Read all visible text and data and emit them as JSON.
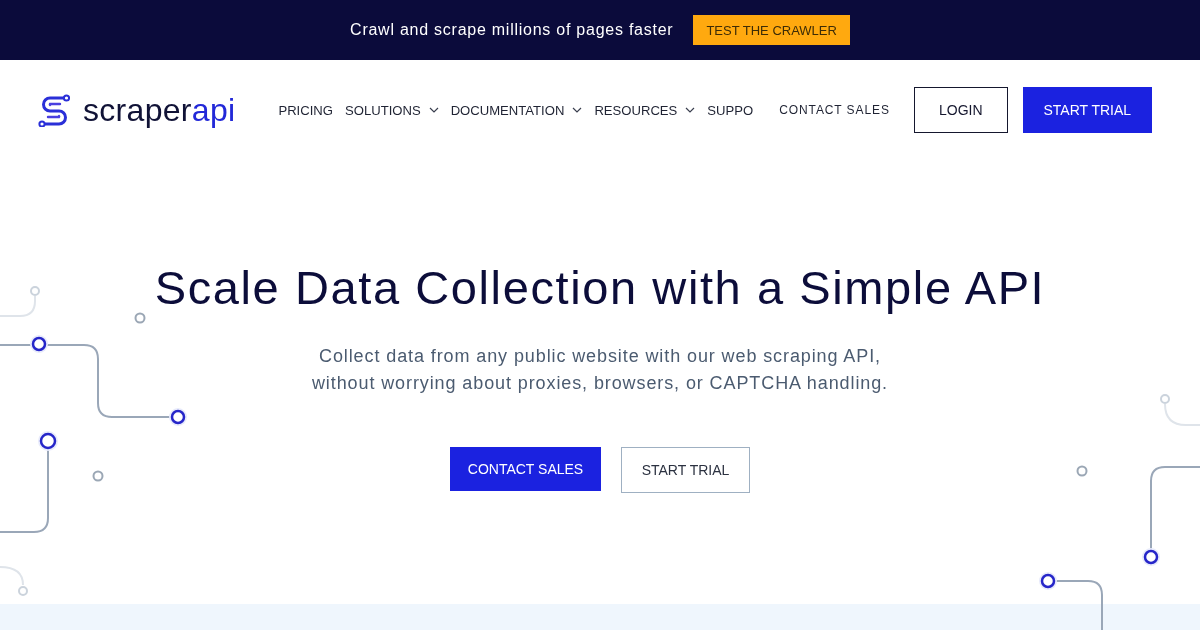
{
  "promo_bar": {
    "text": "Crawl and scrape millions of pages faster",
    "button": "TEST THE CRAWLER"
  },
  "header": {
    "logo": {
      "main": "scraper",
      "accent": "api"
    },
    "nav": [
      {
        "label": "PRICING",
        "has_menu": false
      },
      {
        "label": "SOLUTIONS",
        "has_menu": true
      },
      {
        "label": "DOCUMENTATION",
        "has_menu": true
      },
      {
        "label": "RESOURCES",
        "has_menu": true
      },
      {
        "label": "SUPPO",
        "has_menu": false
      }
    ],
    "contact_link": "CONTACT SALES",
    "actions": [
      {
        "label": "LOGIN",
        "kind": "outline"
      },
      {
        "label": "START TRIAL",
        "kind": "primary"
      }
    ]
  },
  "hero": {
    "title": "Scale Data Collection with a Simple API",
    "subtitle": "Collect data from any public website with our web scraping API, without worrying about proxies, browsers, or CAPTCHA handling.",
    "buttons": [
      {
        "label": "CONTACT SALES",
        "kind": "primary"
      },
      {
        "label": "START TRIAL",
        "kind": "outline"
      }
    ]
  }
}
